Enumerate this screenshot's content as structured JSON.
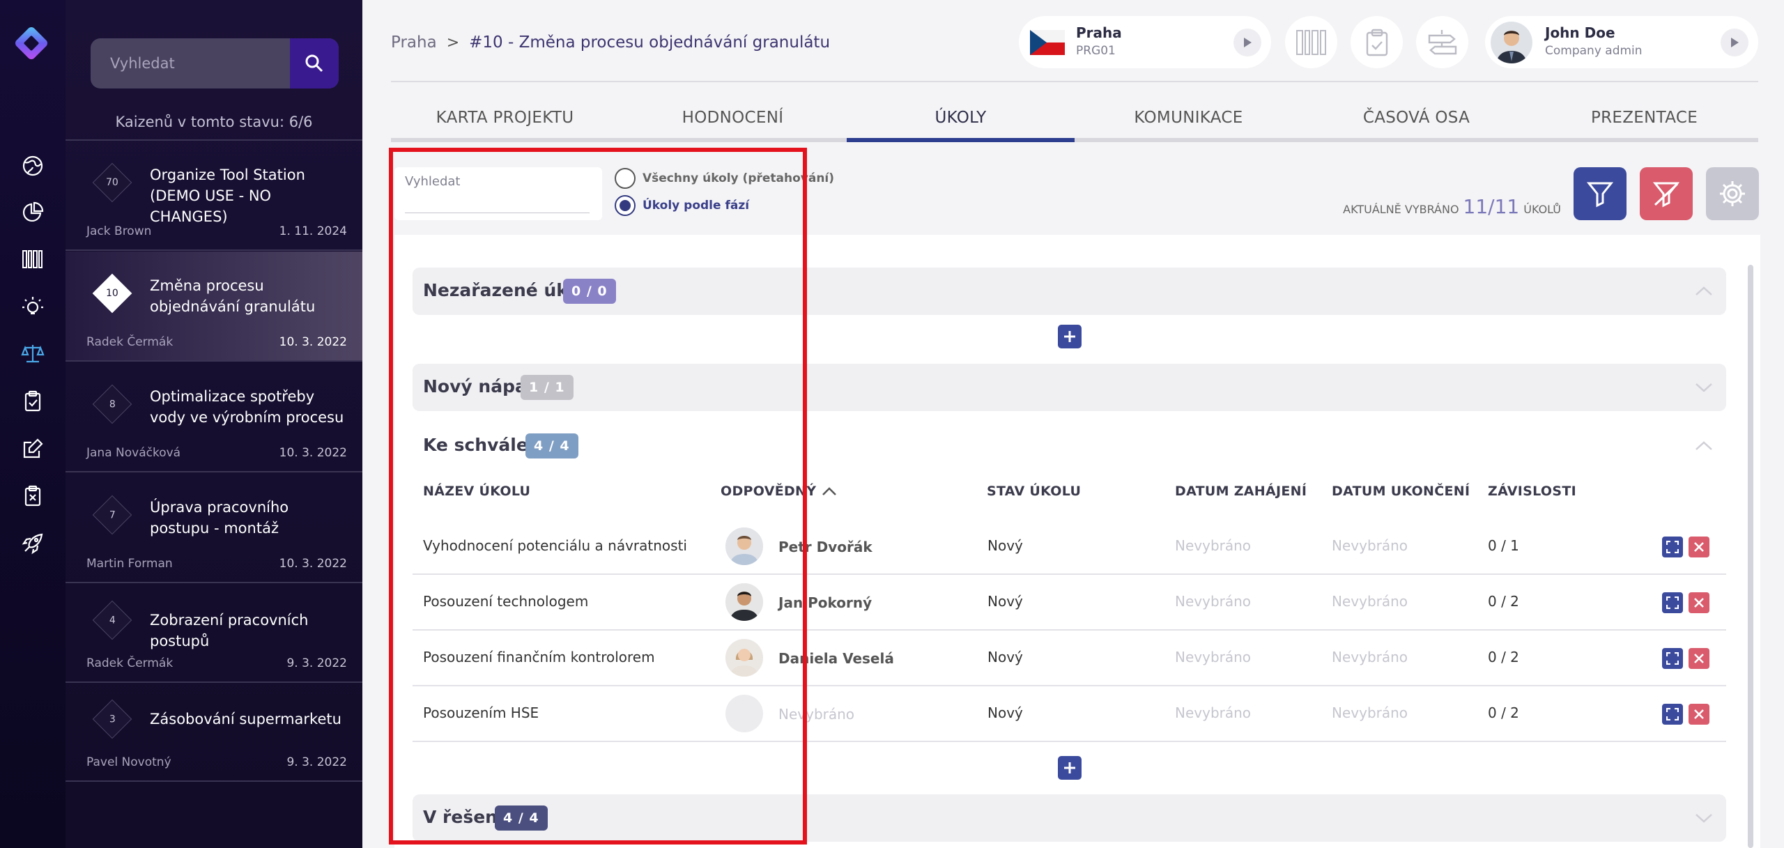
{
  "sidebar": {
    "search_placeholder": "Vyhledat",
    "count_label": "Kaizenů v tomto stavu: 6/6",
    "items": [
      {
        "num": "70",
        "title": "Organize Tool Station (DEMO USE - NO CHANGES)",
        "owner": "Jack Brown",
        "date": "1. 11. 2024"
      },
      {
        "num": "10",
        "title": "Změna procesu objednávání granulátu",
        "owner": "Radek Čermák",
        "date": "10. 3. 2022"
      },
      {
        "num": "8",
        "title": "Optimalizace spotřeby vody ve výrobním procesu",
        "owner": "Jana Nováčková",
        "date": "10. 3. 2022"
      },
      {
        "num": "7",
        "title": "Úprava pracovního postupu - montáž",
        "owner": "Martin Forman",
        "date": "10. 3. 2022"
      },
      {
        "num": "4",
        "title": "Zobrazení pracovních postupů",
        "owner": "Radek Čermák",
        "date": "9. 3. 2022"
      },
      {
        "num": "3",
        "title": "Zásobování supermarketu",
        "owner": "Pavel Novotný",
        "date": "9. 3. 2022"
      }
    ]
  },
  "header": {
    "crumb_root": "Praha",
    "crumb_sep": ">",
    "crumb_current": "#10 - Změna procesu objednávání granulátu",
    "location_name": "Praha",
    "location_code": "PRG01",
    "user_name": "John Doe",
    "user_role": "Company admin"
  },
  "tabs": [
    "KARTA PROJEKTU",
    "HODNOCENÍ",
    "ÚKOLY",
    "KOMUNIKACE",
    "ČASOVÁ OSA",
    "PREZENTACE"
  ],
  "toolbar": {
    "search_label": "Vyhledat",
    "radio_all": "Všechny úkoly (přetahování)",
    "radio_phases": "Úkoly podle fází",
    "selected_prefix": "AKTUÁLNĚ VYBRÁNO",
    "selected_value": "11/11",
    "selected_suffix": "ÚKOLŮ"
  },
  "sections": {
    "unassigned": {
      "title": "Nezařazené úkoly",
      "count": "0 / 0"
    },
    "new_idea": {
      "title": "Nový nápad",
      "count": "1 / 1"
    },
    "approval": {
      "title": "Ke schválení",
      "count": "4 / 4"
    },
    "in_progress": {
      "title": "V řešení",
      "count": "4 / 4"
    }
  },
  "table": {
    "headers": [
      "NÁZEV ÚKOLU",
      "ODPOVĚDNÝ",
      "STAV ÚKOLU",
      "DATUM ZAHÁJENÍ",
      "DATUM UKONČENÍ",
      "ZÁVISLOSTI"
    ],
    "rows": [
      {
        "name": "Vyhodnocení potenciálu a návratnosti",
        "responsible": "Petr Dvořák",
        "status": "Nový",
        "start": "Nevybráno",
        "end": "Nevybráno",
        "deps": "0 / 1"
      },
      {
        "name": "Posouzení technologem",
        "responsible": "Jan Pokorný",
        "status": "Nový",
        "start": "Nevybráno",
        "end": "Nevybráno",
        "deps": "0 / 2"
      },
      {
        "name": "Posouzení finančním kontrolorem",
        "responsible": "Daniela Veselá",
        "status": "Nový",
        "start": "Nevybráno",
        "end": "Nevybráno",
        "deps": "0 / 2"
      },
      {
        "name": "Posouzením HSE",
        "responsible": "Nevybráno",
        "status": "Nový",
        "start": "Nevybráno",
        "end": "Nevybráno",
        "deps": "0 / 2"
      }
    ]
  },
  "icons": {
    "rail": [
      "globe-icon",
      "pie-chart-icon",
      "barcode-icon",
      "lightbulb-icon",
      "scales-icon",
      "clipboard-check-icon",
      "edit-icon",
      "clipboard-x-icon",
      "rocket-icon"
    ]
  },
  "colors": {
    "accent": "#3b4a9d",
    "danger": "#d95b6c",
    "highlight_box": "#e4121c"
  }
}
